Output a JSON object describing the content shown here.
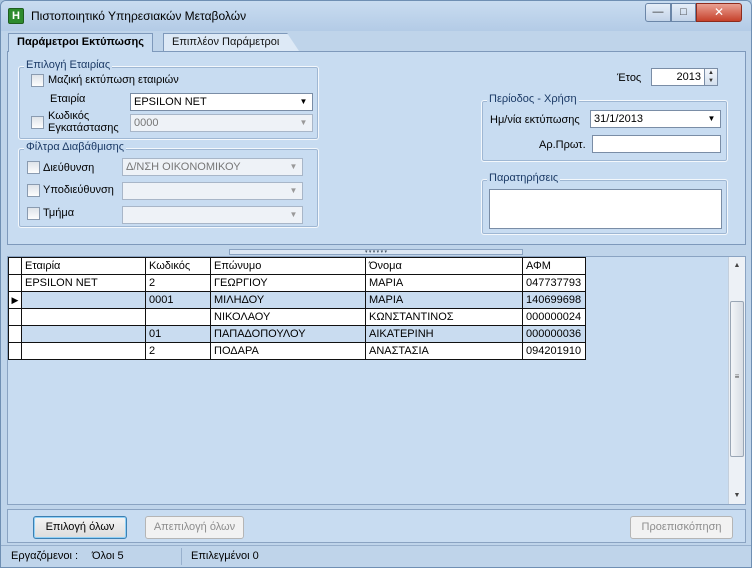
{
  "window": {
    "title": "Πιστοποιητικό Υπηρεσιακών Μεταβολών",
    "icon": "H",
    "controls": {
      "minimize": "—",
      "maximize": "□",
      "close": "✕"
    }
  },
  "tabs": [
    {
      "label": "Παράμετροι Εκτύπωσης",
      "active": true
    },
    {
      "label": "Επιπλέον Παράμετροι",
      "active": false
    }
  ],
  "company_group": {
    "title": "Επιλογή Εταιρίας",
    "mass_print_label": "Μαζική εκτύπωση εταιριών",
    "company_label": "Εταιρία",
    "company_value": "EPSILON NET",
    "install_code_label_1": "Κωδικός",
    "install_code_label_2": "Εγκατάστασης",
    "install_code_value": "0000"
  },
  "hierarchy_group": {
    "title": "Φίλτρα Διαβάθμισης",
    "directorate_label": "Διεύθυνση",
    "directorate_value": "Δ/ΝΣΗ ΟΙΚΟΝΟΜΙΚΟΥ",
    "subdirectorate_label": "Υποδιεύθυνση",
    "subdirectorate_value": "",
    "department_label": "Τμήμα",
    "department_value": ""
  },
  "year": {
    "label": "Έτος",
    "value": "2013"
  },
  "period_group": {
    "title": "Περίοδος - Χρήση",
    "print_date_label": "Ημ/νία εκτύπωσης",
    "print_date_value": "31/1/2013",
    "protocol_label": "Αρ.Πρωτ.",
    "protocol_value": ""
  },
  "remarks_group": {
    "title": "Παρατηρήσεις",
    "value": ""
  },
  "grid": {
    "columns": [
      "Εταιρία",
      "Κωδικός",
      "Επώνυμο",
      "Όνομα",
      "ΑΦΜ"
    ],
    "rows": [
      {
        "company": "EPSILON NET",
        "code": "2",
        "surname": "ΓΕΩΡΓΙΟΥ",
        "name": "ΜΑΡΙΑ",
        "afm": "047737793"
      },
      {
        "company": "",
        "code": "0001",
        "surname": "ΜΙΛΗΔΟΥ",
        "name": "ΜΑΡΙΑ",
        "afm": "140699698"
      },
      {
        "company": "",
        "code": "",
        "surname": "ΝΙΚΟΛΑΟΥ",
        "name": "ΚΩΝΣΤΑΝΤΙΝΟΣ",
        "afm": "000000024"
      },
      {
        "company": "",
        "code": "01",
        "surname": "ΠΑΠΑΔΟΠΟΥΛΟΥ",
        "name": "ΑΙΚΑΤΕΡΙΝΗ",
        "afm": "000000036"
      },
      {
        "company": "",
        "code": "2",
        "surname": "ΠΟΔΑΡΑ",
        "name": "ΑΝΑΣΤΑΣΙΑ",
        "afm": "094201910"
      }
    ],
    "current_row": 1
  },
  "buttons": {
    "select_all": "Επιλογή όλων",
    "deselect_all": "Απεπιλογή όλων",
    "preview": "Προεπισκόπηση"
  },
  "status": {
    "employees_label": "Εργαζόμενοι :",
    "employees_value": "Όλοι 5",
    "selected": "Επιλεγμένοι 0"
  }
}
